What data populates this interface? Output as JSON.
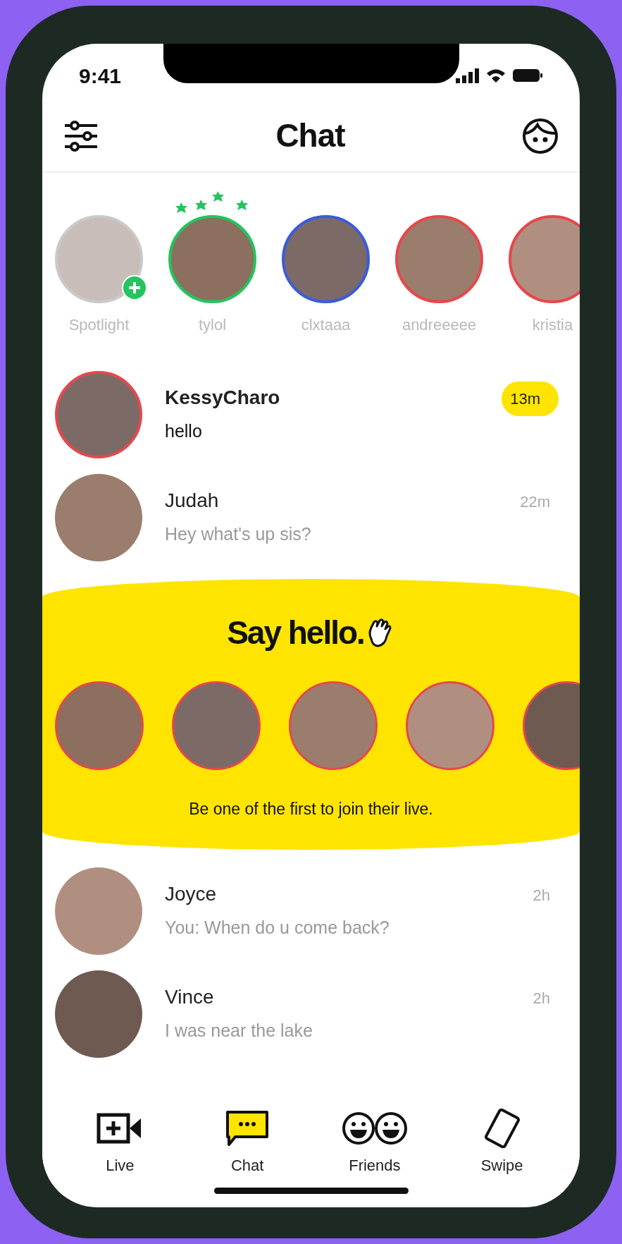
{
  "status_bar": {
    "time": "9:41"
  },
  "header": {
    "title": "Chat"
  },
  "stories": [
    {
      "name": "Spotlight",
      "kind": "add",
      "color": "#c9c9c9"
    },
    {
      "name": "tylol",
      "kind": "sparkle",
      "color": "#22c55e"
    },
    {
      "name": "clxtaaa",
      "kind": "plain",
      "color": "#3b5bdb"
    },
    {
      "name": "andreeeee",
      "kind": "plain",
      "color": "#e5484d"
    },
    {
      "name": "kristia",
      "kind": "plain",
      "color": "#e5484d"
    }
  ],
  "chats": [
    {
      "name": "KessyCharo",
      "message": "hello",
      "time": "13m",
      "unread": true
    },
    {
      "name": "Judah",
      "message": "Hey what's up sis?",
      "time": "22m",
      "unread": false
    },
    {
      "name": "Joyce",
      "message": "You: When do u come back?",
      "time": "2h",
      "unread": false
    },
    {
      "name": "Vince",
      "message": "I was near the lake",
      "time": "2h",
      "unread": false
    }
  ],
  "banner": {
    "title": "Say hello.",
    "subtitle": "Be one of the first to join their live."
  },
  "tabs": [
    {
      "label": "Live",
      "kind": "live",
      "selected": false
    },
    {
      "label": "Chat",
      "kind": "chat",
      "selected": true
    },
    {
      "label": "Friends",
      "kind": "friends",
      "selected": false
    },
    {
      "label": "Swipe",
      "kind": "swipe",
      "selected": false
    }
  ]
}
